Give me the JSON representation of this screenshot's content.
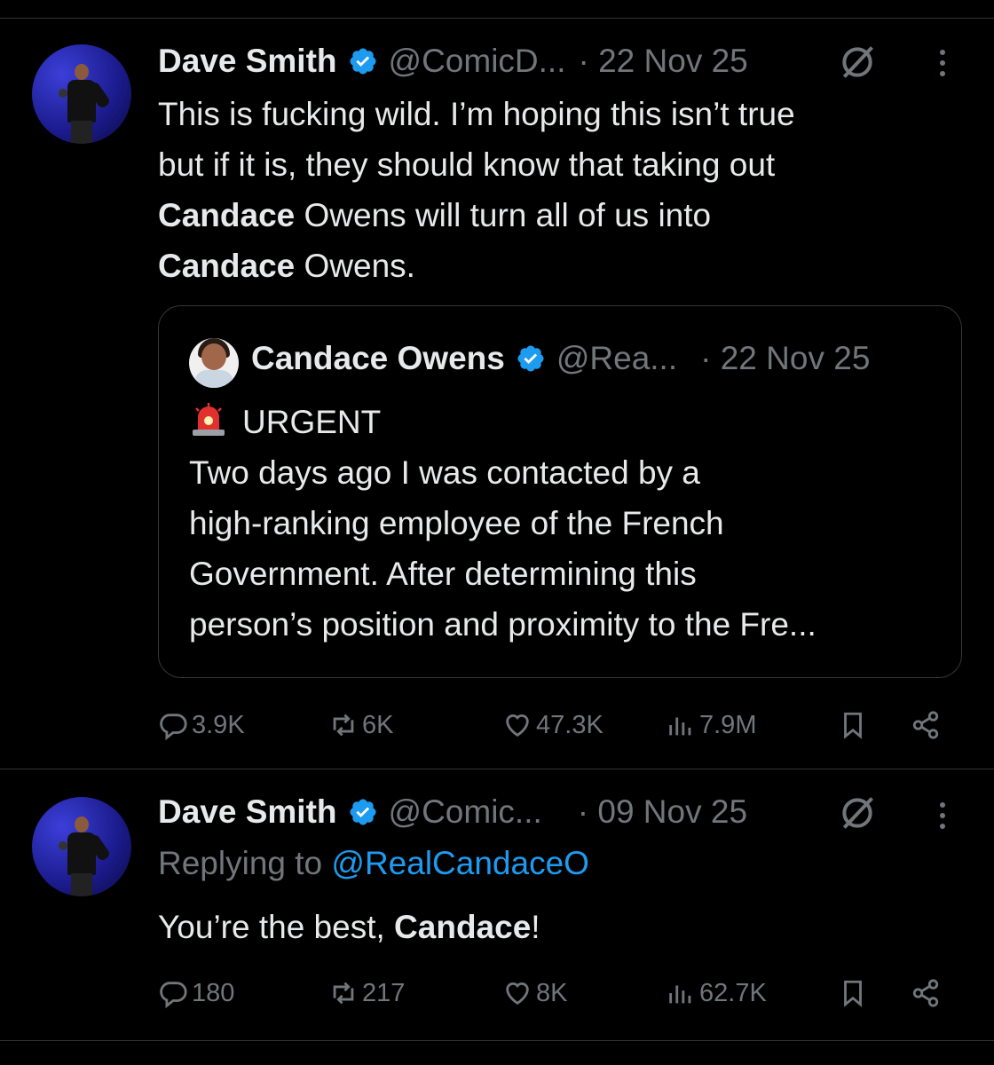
{
  "tweets": [
    {
      "author_name": "Dave Smith",
      "handle": "@ComicD...",
      "date": "· 22 Nov 25",
      "text_line1": "This is fucking wild. I’m hoping this isn’t true",
      "text_line2": "but if it is, they should know that taking out",
      "text_line3_bold": "Candace",
      "text_line3_rest": " Owens will turn all of us into",
      "text_line4_bold": "Candace",
      "text_line4_rest": " Owens.",
      "quote": {
        "author_name": "Candace Owens",
        "handle": "@Rea...",
        "date": "· 22 Nov 25",
        "line1": "URGENT",
        "line2": "Two days ago I was contacted by a",
        "line3": "high-ranking employee of the French",
        "line4": "Government. After determining this",
        "line5": "person’s position and proximity to the Fre..."
      },
      "replies": "3.9K",
      "reposts": "6K",
      "likes": "47.3K",
      "views": "7.9M"
    },
    {
      "author_name": "Dave Smith",
      "handle": "@Comic...",
      "date": "· 09 Nov 25",
      "replying_label": "Replying to ",
      "replying_handle": "@RealCandaceO",
      "text_pre": "You’re the best, ",
      "text_bold": "Candace",
      "text_post": "!",
      "replies": "180",
      "reposts": "217",
      "likes": "8K",
      "views": "62.7K"
    }
  ],
  "colors": {
    "background": "#000000",
    "text": "#e7e9ea",
    "muted": "#71767b",
    "link": "#1d9bf0",
    "verified": "#1d9bf0",
    "divider": "#2f3336"
  },
  "icons": [
    "verified-badge-icon",
    "grok-icon",
    "more-icon",
    "reply-icon",
    "repost-icon",
    "like-icon",
    "views-icon",
    "bookmark-icon",
    "share-icon",
    "siren-emoji-icon"
  ]
}
